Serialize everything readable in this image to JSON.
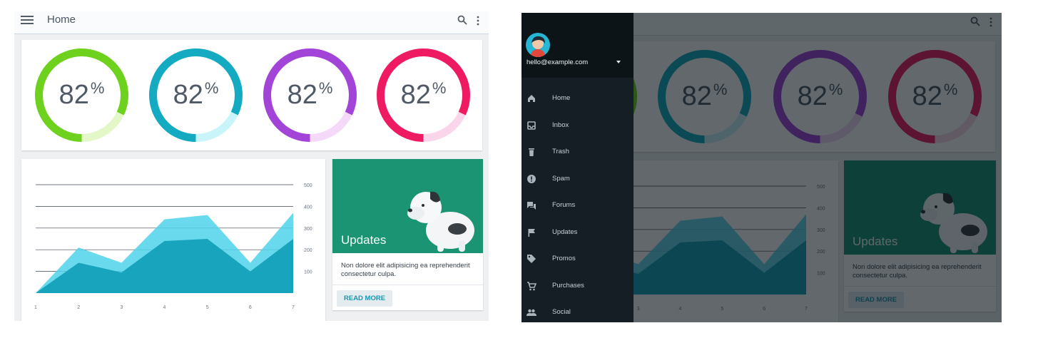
{
  "app": {
    "title": "Home"
  },
  "icons": {
    "menu": "menu-icon",
    "search": "search-icon",
    "more": "more-vert-icon"
  },
  "gauges": [
    {
      "value": "82",
      "unit": "%",
      "percent": 82,
      "color": "#6ed11e",
      "track": "#e4f7c8"
    },
    {
      "value": "82",
      "unit": "%",
      "percent": 82,
      "color": "#14abc2",
      "track": "#c9f4fa"
    },
    {
      "value": "82",
      "unit": "%",
      "percent": 82,
      "color": "#a244d8",
      "track": "#f4d9f9"
    },
    {
      "value": "82",
      "unit": "%",
      "percent": 82,
      "color": "#ee1b62",
      "track": "#fbd6ea"
    }
  ],
  "chart_data": {
    "type": "area",
    "x": [
      "1",
      "2",
      "3",
      "4",
      "5",
      "6",
      "7"
    ],
    "series": [
      {
        "values": [
          0,
          210,
          140,
          340,
          360,
          140,
          370
        ],
        "color": "#4fd2ea"
      },
      {
        "values": [
          0,
          140,
          95,
          240,
          250,
          100,
          250
        ],
        "color": "#14a1b9"
      }
    ],
    "yticks": [
      "500",
      "400",
      "300",
      "200",
      "100"
    ],
    "ylim": [
      0,
      500
    ],
    "second_axis_tick": "500"
  },
  "updates": {
    "title": "Updates",
    "body": "Non dolore elit adipisicing ea reprehenderit consectetur culpa.",
    "button": "READ MORE",
    "hero_color": "#1a9473"
  },
  "drawer": {
    "email": "hello@example.com",
    "items": [
      {
        "label": "Home",
        "icon": "home-icon"
      },
      {
        "label": "Inbox",
        "icon": "inbox-icon"
      },
      {
        "label": "Trash",
        "icon": "trash-icon"
      },
      {
        "label": "Spam",
        "icon": "spam-icon"
      },
      {
        "label": "Forums",
        "icon": "forum-icon"
      },
      {
        "label": "Updates",
        "icon": "flag-icon"
      },
      {
        "label": "Promos",
        "icon": "tag-icon"
      },
      {
        "label": "Purchases",
        "icon": "cart-icon"
      },
      {
        "label": "Social",
        "icon": "people-icon"
      }
    ]
  }
}
